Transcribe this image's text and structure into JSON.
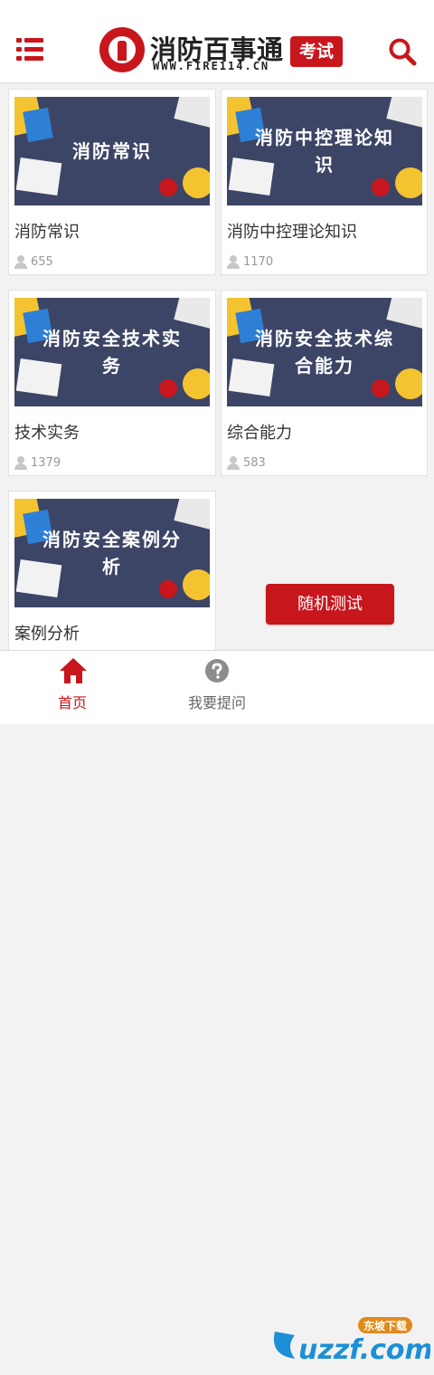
{
  "header": {
    "logo_cn": "消防百事通",
    "logo_en": "WWW.FIRE114.CN",
    "logo_badge": "考试",
    "colors": {
      "accent": "#c8161d"
    },
    "icons": {
      "menu": "menu-icon",
      "search": "search-icon"
    }
  },
  "cards": [
    {
      "thumb_title": "消防常识",
      "name": "消防常识",
      "count": "655"
    },
    {
      "thumb_title": "消防中控理论知识",
      "name": "消防中控理论知识",
      "count": "1170"
    },
    {
      "thumb_title": "消防安全技术实务",
      "name": "技术实务",
      "count": "1379"
    },
    {
      "thumb_title": "消防安全技术综合能力",
      "name": "综合能力",
      "count": "583"
    },
    {
      "thumb_title": "消防安全案例分析",
      "name": "案例分析"
    }
  ],
  "random_test_label": "随机测试",
  "tabbar": {
    "home": {
      "label": "首页",
      "icon": "home-icon",
      "active": true
    },
    "ask": {
      "label": "我要提问",
      "icon": "question-icon"
    },
    "watermark_text": "uzzf.com",
    "watermark_sub": "东坡下载"
  }
}
